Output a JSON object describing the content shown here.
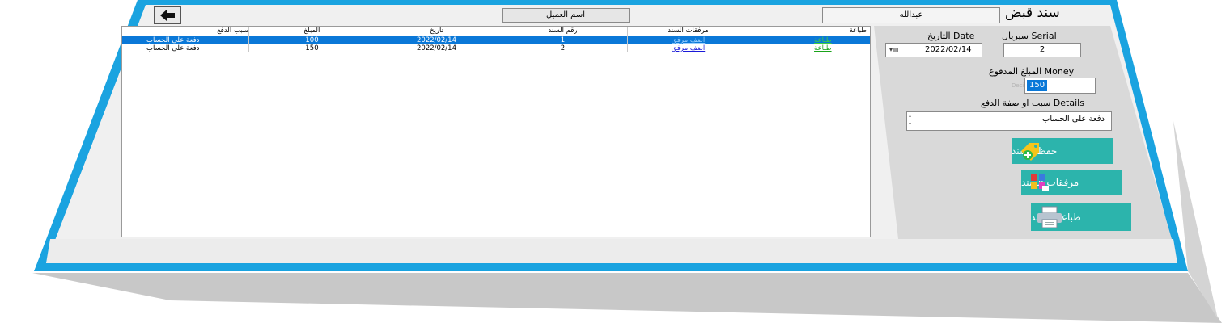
{
  "header": {
    "title": "سند قبض",
    "client_label": "اسم العميل",
    "client_name": "عبدالله"
  },
  "table": {
    "columns": [
      "طباعة",
      "مرفقات السند",
      "رقم السند",
      "تاريخ",
      "المبلغ",
      "سبب الدفع"
    ],
    "rows": [
      {
        "print": "طباعة",
        "attach": "اضف مرفق",
        "no": "1",
        "date": "2022/02/14",
        "amount": "100",
        "reason": "دفعة على الحساب",
        "selected": true
      },
      {
        "print": "طباعة",
        "attach": "اضف مرفق",
        "no": "2",
        "date": "2022/02/14",
        "amount": "150",
        "reason": "دفعة على الحساب",
        "selected": false
      }
    ]
  },
  "form": {
    "serial_label": "سيريال Serial",
    "serial_value": "2",
    "date_label": "التاريخ Date",
    "date_value": "2022/02/14",
    "money_label": "المبلغ المدفوع Money",
    "money_value": "150",
    "money_hint": "Deci",
    "details_label": "سبب او صفة الدفع Details",
    "details_value": "دفعة على الحساب"
  },
  "buttons": {
    "save": "حفظ السند",
    "attachments": "مرفقات السند",
    "print": "طباعة السند"
  },
  "colors": {
    "frame": "#1aa3e0",
    "accent": "#2cb4ac",
    "selected_row": "#0a78d8"
  }
}
